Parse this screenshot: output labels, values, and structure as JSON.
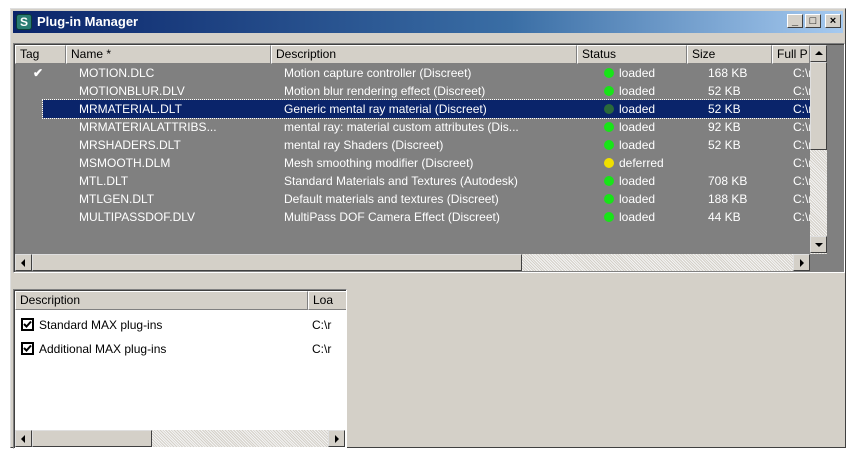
{
  "window": {
    "title": "Plug-in Manager",
    "buttons": {
      "minimize": "_",
      "maximize": "□",
      "close": "×"
    }
  },
  "plugin_table": {
    "columns": [
      "Tag",
      "Name *",
      "Description",
      "Status",
      "Size",
      "Full P"
    ],
    "rows": [
      {
        "tag": "✔",
        "name": "MOTION.DLC",
        "description": "Motion capture controller (Discreet)",
        "status": "loaded",
        "status_color": "#18e418",
        "size": "168 KB",
        "path": "C:\\m"
      },
      {
        "tag": "",
        "name": "MOTIONBLUR.DLV",
        "description": "Motion blur rendering effect (Discreet)",
        "status": "loaded",
        "status_color": "#18e418",
        "size": "52 KB",
        "path": "C:\\m"
      },
      {
        "tag": "",
        "name": "MRMATERIAL.DLT",
        "description": "Generic mental ray material (Discreet)",
        "status": "loaded",
        "status_color": "#2a6a3a",
        "size": "52 KB",
        "path": "C:\\m",
        "selected": true
      },
      {
        "tag": "",
        "name": "MRMATERIALATTRIBS...",
        "description": "mental ray: material custom attributes (Dis...",
        "status": "loaded",
        "status_color": "#18e418",
        "size": "92 KB",
        "path": "C:\\m"
      },
      {
        "tag": "",
        "name": "MRSHADERS.DLT",
        "description": "mental ray Shaders (Discreet)",
        "status": "loaded",
        "status_color": "#18e418",
        "size": "52 KB",
        "path": "C:\\m"
      },
      {
        "tag": "",
        "name": "MSMOOTH.DLM",
        "description": "Mesh smoothing modifier (Discreet)",
        "status": "deferred",
        "status_color": "#f0e000",
        "size": "",
        "path": "C:\\m"
      },
      {
        "tag": "",
        "name": "MTL.DLT",
        "description": "Standard Materials and Textures (Autodesk)",
        "status": "loaded",
        "status_color": "#18e418",
        "size": "708 KB",
        "path": "C:\\m"
      },
      {
        "tag": "",
        "name": "MTLGEN.DLT",
        "description": "Default materials and textures (Discreet)",
        "status": "loaded",
        "status_color": "#18e418",
        "size": "188 KB",
        "path": "C:\\m"
      },
      {
        "tag": "",
        "name": "MULTIPASSDOF.DLV",
        "description": "MultiPass DOF Camera Effect (Discreet)",
        "status": "loaded",
        "status_color": "#18e418",
        "size": "44 KB",
        "path": "C:\\m"
      }
    ]
  },
  "paths_panel": {
    "columns": [
      "Description",
      "Loa"
    ],
    "rows": [
      {
        "checked": true,
        "description": "Standard MAX plug-ins",
        "location": "C:\\r"
      },
      {
        "checked": true,
        "description": "Additional MAX plug-ins",
        "location": "C:\\r"
      }
    ]
  },
  "colors": {
    "list_bg": "#808080",
    "selection": "#0a246a",
    "titlebar": "#0a246a"
  }
}
